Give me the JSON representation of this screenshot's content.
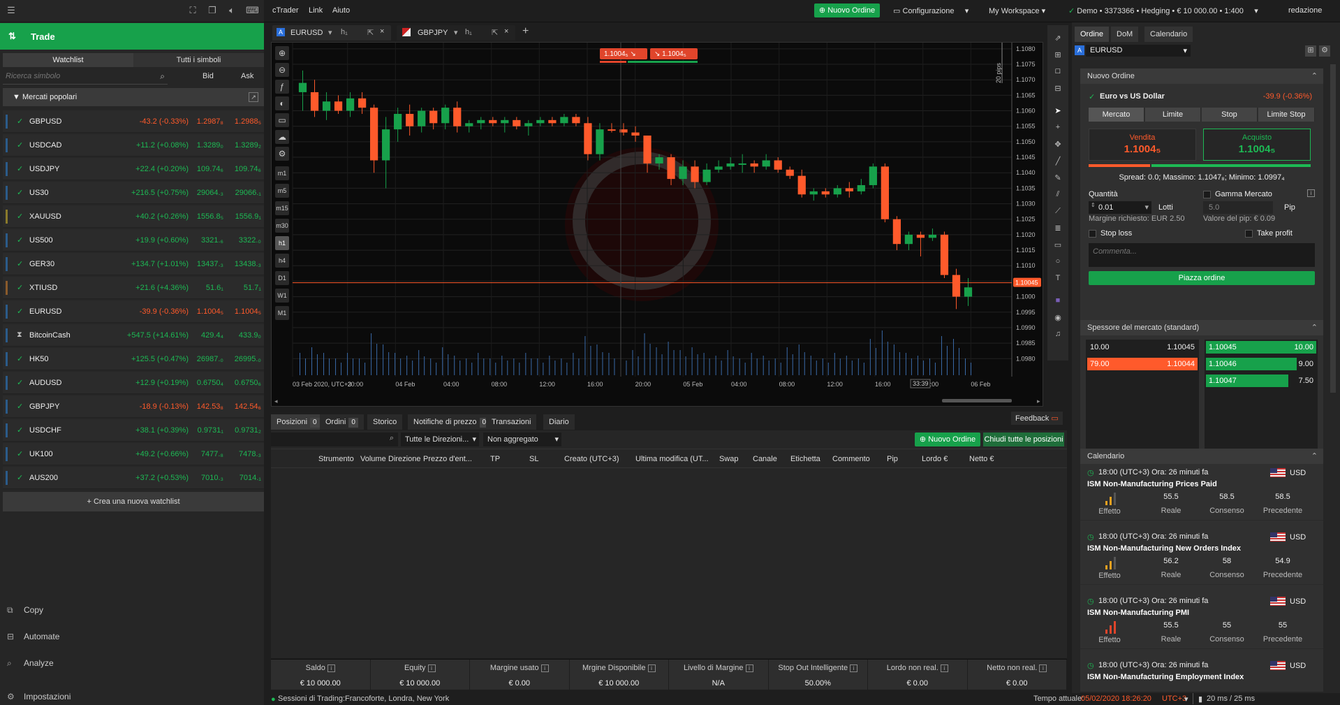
{
  "topbar": {
    "menu": [
      "cTrader",
      "Link",
      "Aiuto"
    ],
    "new_order": "Nuovo Ordine",
    "config": "Configurazione",
    "workspace": "My Workspace",
    "account": "Demo • 3373366 • Hedging • € 10 000.00 • 1:400",
    "user": "redazione"
  },
  "left": {
    "trade_label": "Trade",
    "tabs": [
      "Watchlist",
      "Tutti i simboli"
    ],
    "search_placeholder": "Ricerca simbolo",
    "col_bid": "Bid",
    "col_ask": "Ask",
    "group": "Mercati popolari",
    "rows": [
      {
        "sym": "GBPUSD",
        "chg": "-43.2 (-0.33%)",
        "dir": "dn",
        "bid": "1.2987₈",
        "ask": "1.2988₅"
      },
      {
        "sym": "USDCAD",
        "chg": "+11.2 (+0.08%)",
        "dir": "up",
        "bid": "1.3289₀",
        "ask": "1.3289₂"
      },
      {
        "sym": "USDJPY",
        "chg": "+22.4 (+0.20%)",
        "dir": "up",
        "bid": "109.74₆",
        "ask": "109.74₆"
      },
      {
        "sym": "US30",
        "chg": "+216.5 (+0.75%)",
        "dir": "up",
        "bid": "29064.₃",
        "ask": "29066.₁"
      },
      {
        "sym": "XAUUSD",
        "chg": "+40.2 (+0.26%)",
        "dir": "up",
        "bid": "1556.8₅",
        "ask": "1556.9₁"
      },
      {
        "sym": "US500",
        "chg": "+19.9 (+0.60%)",
        "dir": "up",
        "bid": "3321.₆",
        "ask": "3322.₀"
      },
      {
        "sym": "GER30",
        "chg": "+134.7 (+1.01%)",
        "dir": "up",
        "bid": "13437.₃",
        "ask": "13438.₃"
      },
      {
        "sym": "XTIUSD",
        "chg": "+21.6 (+4.36%)",
        "dir": "up",
        "bid": "51.6₁",
        "ask": "51.7₁"
      },
      {
        "sym": "EURUSD",
        "chg": "-39.9 (-0.36%)",
        "dir": "dn",
        "bid": "1.1004₅",
        "ask": "1.1004₅"
      },
      {
        "sym": "BitcoinCash",
        "chg": "+547.5 (+14.61%)",
        "dir": "up",
        "bid": "429.4₄",
        "ask": "433.9₀"
      },
      {
        "sym": "HK50",
        "chg": "+125.5 (+0.47%)",
        "dir": "up",
        "bid": "26987.₀",
        "ask": "26995.₀"
      },
      {
        "sym": "AUDUSD",
        "chg": "+12.9 (+0.19%)",
        "dir": "up",
        "bid": "0.6750₄",
        "ask": "0.6750₆"
      },
      {
        "sym": "GBPJPY",
        "chg": "-18.9 (-0.13%)",
        "dir": "dn",
        "bid": "142.53₈",
        "ask": "142.54₆"
      },
      {
        "sym": "USDCHF",
        "chg": "+38.1 (+0.39%)",
        "dir": "up",
        "bid": "0.9731₁",
        "ask": "0.9731₂"
      },
      {
        "sym": "UK100",
        "chg": "+49.2 (+0.66%)",
        "dir": "up",
        "bid": "7477.₈",
        "ask": "7478.₃"
      },
      {
        "sym": "AUS200",
        "chg": "+37.2 (+0.53%)",
        "dir": "up",
        "bid": "7010.₃",
        "ask": "7014.₁"
      }
    ],
    "new_watchlist": "+ Crea una nuova watchlist",
    "nav": [
      "Copy",
      "Automate",
      "Analyze",
      "Impostazioni"
    ]
  },
  "chart": {
    "tab1": "EURUSD",
    "tab1_tf": "h₁",
    "tab2": "GBPJPY",
    "tab2_tf": "h₁",
    "sell_price": "1.1004₅",
    "buy_price": "1.1004₅",
    "pips_label": "20 pips",
    "current_price": "1.10045",
    "price_ticks": [
      "1.1080",
      "1.1075",
      "1.1070",
      "1.1065",
      "1.1060",
      "1.1055",
      "1.1050",
      "1.1045",
      "1.1040",
      "1.1035",
      "1.1030",
      "1.1025",
      "1.1020",
      "1.1015",
      "1.1010",
      "1.1005",
      "1.1000",
      "1.0995",
      "1.0990",
      "1.0985",
      "1.0980"
    ],
    "time_ticks": [
      "03 Feb 2020, UTC+3",
      "20:00",
      "04 Feb",
      "04:00",
      "08:00",
      "12:00",
      "16:00",
      "20:00",
      "05 Feb",
      "04:00",
      "08:00",
      "12:00",
      "16:00",
      "20:00",
      "06 Feb"
    ],
    "countdown": "33:39",
    "tf_buttons": [
      "m1",
      "m5",
      "m15",
      "m30",
      "h1",
      "h4",
      "D1",
      "W1",
      "M1"
    ],
    "candles": [
      [
        1.1069,
        1.1073,
        1.106,
        1.1066,
        "up"
      ],
      [
        1.1066,
        1.107,
        1.1058,
        1.106,
        "dn"
      ],
      [
        1.106,
        1.1066,
        1.1057,
        1.1063,
        "up"
      ],
      [
        1.1063,
        1.1065,
        1.1059,
        1.106,
        "dn"
      ],
      [
        1.106,
        1.1066,
        1.1058,
        1.1064,
        "up"
      ],
      [
        1.1064,
        1.1066,
        1.1059,
        1.1061,
        "dn"
      ],
      [
        1.1061,
        1.1062,
        1.104,
        1.1044,
        "dn"
      ],
      [
        1.1044,
        1.1058,
        1.1035,
        1.1054,
        "up"
      ],
      [
        1.1054,
        1.1061,
        1.105,
        1.1059,
        "up"
      ],
      [
        1.1059,
        1.1062,
        1.1052,
        1.1055,
        "dn"
      ],
      [
        1.1055,
        1.1061,
        1.1053,
        1.106,
        "up"
      ],
      [
        1.106,
        1.1061,
        1.1054,
        1.1056,
        "dn"
      ],
      [
        1.1056,
        1.1062,
        1.1054,
        1.1061,
        "up"
      ],
      [
        1.1061,
        1.1063,
        1.1053,
        1.1055,
        "dn"
      ],
      [
        1.1055,
        1.1057,
        1.1053,
        1.1056,
        "up"
      ],
      [
        1.1056,
        1.1058,
        1.1054,
        1.1057,
        "up"
      ],
      [
        1.1057,
        1.1058,
        1.1055,
        1.1056,
        "dn"
      ],
      [
        1.1056,
        1.1058,
        1.1053,
        1.1057,
        "up"
      ],
      [
        1.1057,
        1.1058,
        1.1054,
        1.1055,
        "dn"
      ],
      [
        1.1055,
        1.1057,
        1.1052,
        1.1056,
        "up"
      ],
      [
        1.1056,
        1.1058,
        1.1055,
        1.1057,
        "up"
      ],
      [
        1.1057,
        1.1058,
        1.1055,
        1.1056,
        "dn"
      ],
      [
        1.1056,
        1.1059,
        1.1055,
        1.1058,
        "up"
      ],
      [
        1.1058,
        1.1059,
        1.1055,
        1.1056,
        "dn"
      ],
      [
        1.1056,
        1.1058,
        1.1044,
        1.1046,
        "dn"
      ],
      [
        1.1046,
        1.1056,
        1.1044,
        1.1054,
        "up"
      ],
      [
        1.1054,
        1.1056,
        1.1053,
        1.1054,
        "dn"
      ],
      [
        1.1054,
        1.1056,
        1.1052,
        1.1053,
        "dn"
      ],
      [
        1.1053,
        1.1055,
        1.105,
        1.1052,
        "dn"
      ],
      [
        1.1052,
        1.1052,
        1.104,
        1.1043,
        "dn"
      ],
      [
        1.1043,
        1.1046,
        1.1041,
        1.1045,
        "up"
      ],
      [
        1.1045,
        1.1046,
        1.1036,
        1.1038,
        "dn"
      ],
      [
        1.1038,
        1.1044,
        1.1036,
        1.1042,
        "up"
      ],
      [
        1.1042,
        1.1044,
        1.1035,
        1.1037,
        "dn"
      ],
      [
        1.1037,
        1.1043,
        1.1036,
        1.1041,
        "up"
      ],
      [
        1.1041,
        1.1044,
        1.104,
        1.1042,
        "up"
      ],
      [
        1.1042,
        1.1045,
        1.1041,
        1.1043,
        "up"
      ],
      [
        1.1043,
        1.1046,
        1.104,
        1.1043,
        "up"
      ],
      [
        1.1043,
        1.1044,
        1.104,
        1.1042,
        "dn"
      ],
      [
        1.1042,
        1.1046,
        1.1041,
        1.1044,
        "up"
      ],
      [
        1.1044,
        1.1045,
        1.104,
        1.1041,
        "dn"
      ],
      [
        1.1041,
        1.1042,
        1.1038,
        1.1039,
        "dn"
      ],
      [
        1.1039,
        1.1041,
        1.1032,
        1.1033,
        "dn"
      ],
      [
        1.1033,
        1.1035,
        1.1031,
        1.1034,
        "up"
      ],
      [
        1.1034,
        1.1035,
        1.1032,
        1.1033,
        "dn"
      ],
      [
        1.1033,
        1.1036,
        1.1032,
        1.1035,
        "up"
      ],
      [
        1.1035,
        1.1037,
        1.1032,
        1.1034,
        "dn"
      ],
      [
        1.1034,
        1.1038,
        1.1033,
        1.1036,
        "up"
      ],
      [
        1.1036,
        1.1043,
        1.1035,
        1.1042,
        "up"
      ],
      [
        1.1042,
        1.1043,
        1.1024,
        1.1025,
        "dn"
      ],
      [
        1.1025,
        1.1026,
        1.1015,
        1.1017,
        "dn"
      ],
      [
        1.1017,
        1.1021,
        1.1015,
        1.102,
        "up"
      ],
      [
        1.102,
        1.1021,
        1.1013,
        1.1019,
        "dn"
      ],
      [
        1.1019,
        1.1022,
        1.1018,
        1.102,
        "up"
      ],
      [
        1.102,
        1.1021,
        1.1006,
        1.1007,
        "dn"
      ],
      [
        1.1007,
        1.1009,
        1.0996,
        1.1,
        "dn"
      ],
      [
        1.1,
        1.1006,
        1.0997,
        1.1003,
        "up"
      ]
    ],
    "volumes": [
      0.4,
      0.5,
      0.4,
      0.3,
      0.4,
      0.3,
      0.75,
      0.55,
      0.4,
      0.35,
      0.45,
      0.3,
      0.5,
      0.35,
      0.3,
      0.4,
      0.3,
      0.35,
      0.3,
      0.4,
      0.3,
      0.35,
      0.3,
      0.4,
      0.7,
      0.55,
      0.4,
      0.35,
      0.45,
      0.75,
      0.5,
      0.6,
      0.45,
      0.5,
      0.4,
      0.35,
      0.45,
      0.3,
      0.4,
      0.35,
      0.3,
      0.5,
      0.55,
      0.35,
      0.3,
      0.4,
      0.35,
      0.3,
      0.65,
      0.8,
      0.55,
      0.4,
      0.35,
      0.3,
      0.7,
      0.65,
      0.3
    ]
  },
  "bottom": {
    "tabs": [
      {
        "label": "Posizioni",
        "count": "0"
      },
      {
        "label": "Ordini",
        "count": "0"
      },
      {
        "label": "Storico",
        "count": ""
      },
      {
        "label": "Notifiche di prezzo",
        "count": "0"
      },
      {
        "label": "Transazioni",
        "count": ""
      },
      {
        "label": "Diario",
        "count": ""
      }
    ],
    "feedback": "Feedback",
    "filter_dir": "Tutte le Direzioni...",
    "filter_agg": "Non aggregato",
    "new_order": "Nuovo Ordine",
    "close_all": "Chiudi tutte le posizioni",
    "headers": [
      "Strumento",
      "Volume",
      "Direzione",
      "Prezzo d'ent...",
      "TP",
      "SL",
      "Creato (UTC+3)",
      "Ultima modifica (UT...",
      "Swap",
      "Canale",
      "Etichetta",
      "Commento",
      "Pip",
      "Lordo €",
      "Netto €"
    ],
    "summary": [
      {
        "label": "Saldo",
        "value": "€ 10 000.00"
      },
      {
        "label": "Equity",
        "value": "€ 10 000.00"
      },
      {
        "label": "Margine usato",
        "value": "€ 0.00"
      },
      {
        "label": "Mrgine Disponibile",
        "value": "€ 10 000.00"
      },
      {
        "label": "Livello di Margine",
        "value": "N/A"
      },
      {
        "label": "Stop Out Intelligente",
        "value": "50.00%"
      },
      {
        "label": "Lordo non real.",
        "value": "€ 0.00"
      },
      {
        "label": "Netto non real.",
        "value": "€ 0.00"
      }
    ]
  },
  "status": {
    "sessions": "Sessioni di Trading:Francoforte, Londra, New York",
    "time_label": "Tempo attuale:",
    "time": "05/02/2020 18:26:20",
    "tz": "UTC+3",
    "latency": "20 ms / 25 ms"
  },
  "right": {
    "tabs": [
      "Ordine",
      "DoM",
      "Calendario"
    ],
    "symbol": "EURUSD",
    "new_order_title": "Nuovo Ordine",
    "pair_name": "Euro vs US Dollar",
    "pair_chg": "-39.9 (-0.36%)",
    "order_types": [
      "Mercato",
      "Limite",
      "Stop",
      "Limite Stop"
    ],
    "sell_label": "Vendita",
    "sell_price": "1.1004₅",
    "buy_label": "Acquisto",
    "buy_price": "1.1004₅",
    "spread": "Spread: 0.0; Massimo: 1.1047₈; Minimo: 1.0997₄",
    "qty_label": "Quantità",
    "range_label": "Gamma Mercato",
    "qty": "0.01",
    "lots": "Lotti",
    "pip_val": "5.0",
    "pip": "Pip",
    "margin": "Margine richiesto: EUR 2.50",
    "pip_value": "Valore del pip: € 0.09",
    "stop_loss": "Stop loss",
    "take_profit": "Take profit",
    "comment_placeholder": "Commenta...",
    "place_order": "Piazza ordine",
    "dom_title": "Spessore del mercato (standard)",
    "dom_sell": [
      {
        "vol": "10.00",
        "price": "1.10045"
      },
      {
        "vol": "79.00",
        "price": "1.10044"
      }
    ],
    "dom_buy": [
      {
        "price": "1.10045",
        "vol": "10.00"
      },
      {
        "price": "1.10046",
        "vol": "9.00"
      },
      {
        "price": "1.10047",
        "vol": "7.50"
      }
    ],
    "cal_title": "Calendario",
    "events": [
      {
        "time": "18:00  (UTC+3)  Ora: 26 minuti fa",
        "name": "ISM Non-Manufacturing Prices Paid",
        "cur": "USD",
        "real": "55.5",
        "cons": "58.5",
        "prev": "58.5"
      },
      {
        "time": "18:00  (UTC+3)  Ora: 26 minuti fa",
        "name": "ISM Non-Manufacturing New Orders Index",
        "cur": "USD",
        "real": "56.2",
        "cons": "58",
        "prev": "54.9"
      },
      {
        "time": "18:00  (UTC+3)  Ora: 26 minuti fa",
        "name": "ISM Non-Manufacturing PMI",
        "cur": "USD",
        "real": "55.5",
        "cons": "55",
        "prev": "55"
      },
      {
        "time": "18:00  (UTC+3)  Ora: 26 minuti fa",
        "name": "ISM Non-Manufacturing Employment Index",
        "cur": "USD",
        "real": "",
        "cons": "",
        "prev": ""
      }
    ],
    "cal_labels": {
      "effect": "Effetto",
      "real": "Reale",
      "cons": "Consenso",
      "prev": "Precedente"
    }
  }
}
